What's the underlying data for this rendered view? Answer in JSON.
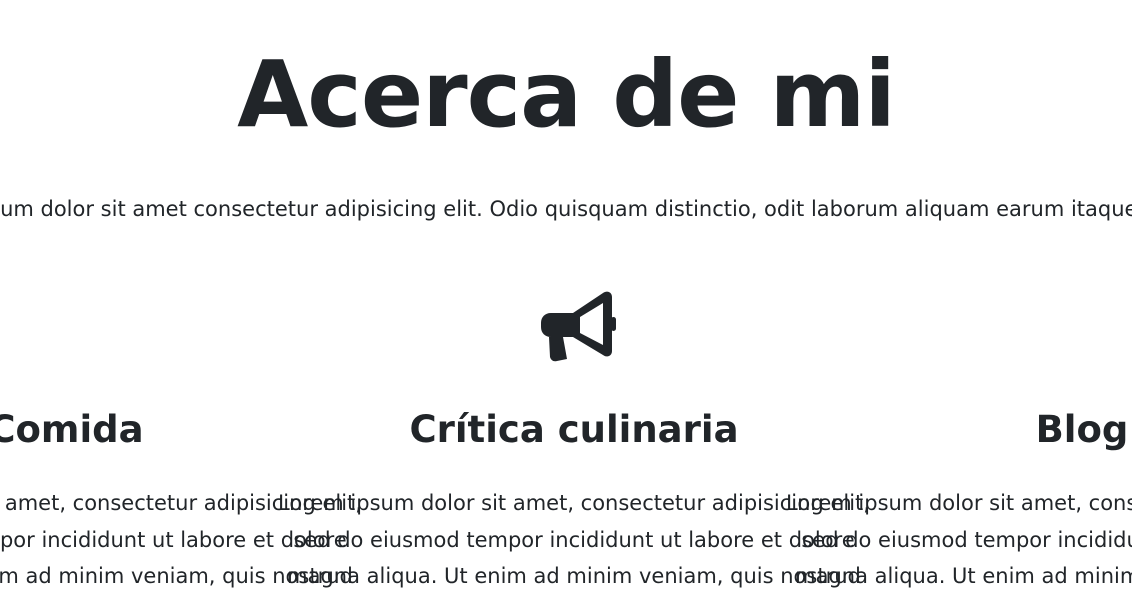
{
  "page": {
    "title": "Acerca de mi",
    "intro": "Lorem ipsum dolor sit amet consectetur adipisicing elit. Odio quisquam distinctio, odit laborum aliquam earum itaque cum sint"
  },
  "icons": {
    "megaphone": "megaphone-icon",
    "color": "#212529"
  },
  "columns": [
    {
      "title": "Comida",
      "lines": [
        "Lorem ipsum dolor sit amet, consectetur adipisicing elit,",
        "sed do eiusmod tempor incididunt ut labore et dolore",
        "magna aliqua. Ut enim ad minim veniam, quis nostrud"
      ]
    },
    {
      "title": "Crítica culinaria",
      "lines": [
        "Lorem ipsum dolor sit amet, consectetur adipisicing elit,",
        "sed do eiusmod tempor incididunt ut labore et dolore",
        "magna aliqua. Ut enim ad minim veniam, quis nostrud"
      ]
    },
    {
      "title": "Blog",
      "lines": [
        "Lorem ipsum dolor sit amet, consectetur adipisicing elit,",
        "sed do eiusmod tempor incididunt ut labore et dolore",
        "magna aliqua. Ut enim ad minim veniam, quis nostrud"
      ]
    }
  ]
}
